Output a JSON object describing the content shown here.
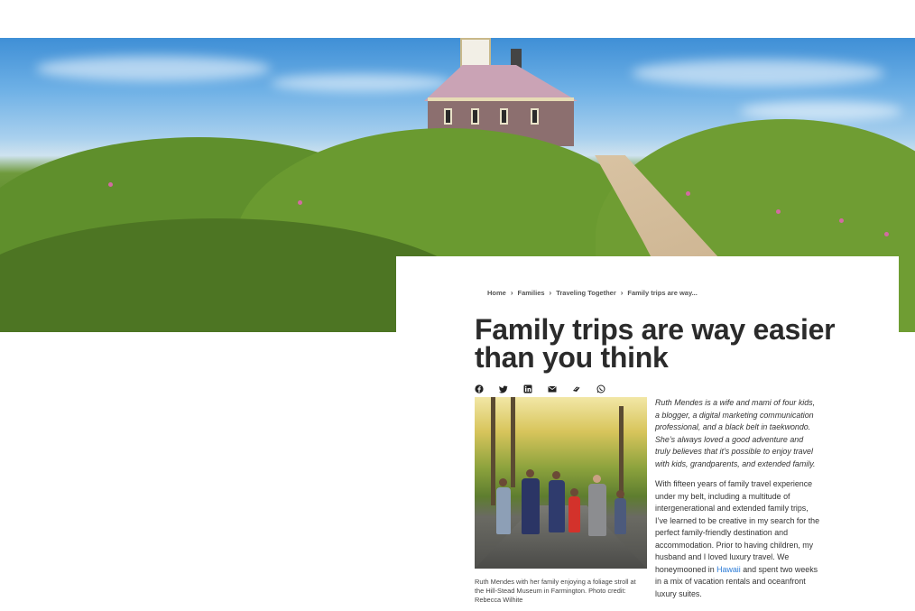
{
  "breadcrumb": {
    "items": [
      "Home",
      "Families",
      "Traveling Together",
      "Family trips are way..."
    ],
    "separator": "›"
  },
  "article": {
    "title": "Family trips are way easier than you think",
    "share_icons": [
      "facebook-icon",
      "twitter-icon",
      "linkedin-icon",
      "email-icon",
      "link-icon",
      "whatsapp-icon"
    ],
    "photo_caption": "Ruth Mendes with her family enjoying a foliage stroll at the Hill-Stead Museum in Farmington. Photo credit: Rebecca Wilhite",
    "bio": "Ruth Mendes is a wife and mami of four kids, a blogger, a digital marketing communication professional, and a black belt in taekwondo. She’s always loved a good adventure and truly believes that it’s possible to enjoy travel with kids, grandparents, and extended family.",
    "body_before_link": "With fifteen years of family travel experience under my belt, including a multitude of intergenerational and extended family trips, I’ve learned to be creative in my search for the perfect family-friendly destination and accommodation. Prior to having children, my husband and I loved luxury travel. We honeymooned in ",
    "body_link": "Hawaii",
    "body_after_link": " and spent two weeks in a mix of vacation rentals and oceanfront luxury suites."
  },
  "colors": {
    "link": "#2c7bd6",
    "title": "#2b2b2b",
    "text": "#333333"
  }
}
